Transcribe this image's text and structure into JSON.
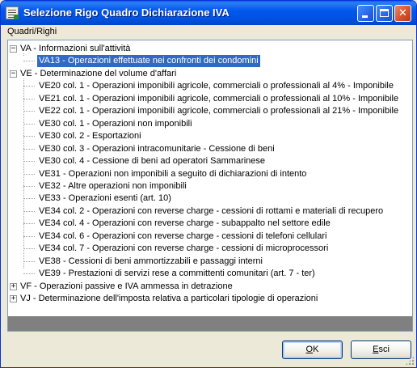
{
  "window": {
    "title": "Selezione Rigo Quadro Dichiarazione IVA",
    "titlebar_color": "#0054e3",
    "controls": {
      "minimize": "minimize-icon",
      "maximize": "maximize-icon",
      "close": "close-icon",
      "close_glyph": "✕"
    }
  },
  "tree": {
    "label": "Quadri/Righi",
    "groups": [
      {
        "expander": "−",
        "label": "VA - Informazioni sull'attività",
        "children": [
          {
            "label": "VA13 - Operazioni effettuate nei confronti dei condomini",
            "selected": true
          }
        ]
      },
      {
        "expander": "−",
        "label": "VE - Determinazione del volume d'affari",
        "children": [
          {
            "label": "VE20 col. 1 - Operazioni imponibili agricole, commerciali o professionali al 4% - Imponibile"
          },
          {
            "label": "VE21 col. 1 - Operazioni imponibili agricole, commerciali o professionali al 10% - Imponibile"
          },
          {
            "label": "VE22 col. 1 - Operazioni imponibili agricole, commerciali o professionali al 21% - Imponibile"
          },
          {
            "label": "VE30 col. 1 - Operazioni non imponibili"
          },
          {
            "label": "VE30 col. 2 - Esportazioni"
          },
          {
            "label": "VE30 col. 3 - Operazioni intracomunitarie - Cessione di beni"
          },
          {
            "label": "VE30 col. 4 - Cessione di beni ad operatori Sammarinese"
          },
          {
            "label": "VE31 - Operazioni non imponibili a seguito di dichiarazioni di intento"
          },
          {
            "label": "VE32 - Altre operazioni non imponibili"
          },
          {
            "label": "VE33 - Operazioni esenti (art. 10)"
          },
          {
            "label": "VE34 col. 2 - Operazioni con reverse charge - cessioni di rottami e materiali di recupero"
          },
          {
            "label": "VE34 col. 4 - Operazioni con reverse charge - subappalto nel settore edile"
          },
          {
            "label": "VE34 col. 6 - Operazioni con reverse charge - cessioni di telefoni cellulari"
          },
          {
            "label": "VE34 col. 7 - Operazioni con reverse charge - cessioni di microprocessori"
          },
          {
            "label": "VE38 - Cessioni di beni ammortizzabili e passaggi interni"
          },
          {
            "label": "VE39 - Prestazioni di servizi rese a committenti comunitari (art. 7 - ter)"
          }
        ]
      },
      {
        "expander": "+",
        "label": "VF - Operazioni passive e IVA ammessa in detrazione",
        "children": []
      },
      {
        "expander": "+",
        "label": "VJ - Determinazione dell'imposta relativa a particolari tipologie di operazioni",
        "children": []
      }
    ]
  },
  "buttons": {
    "ok": "OK",
    "exit": "Esci"
  },
  "colors": {
    "selection": "#316ac5",
    "window_bg": "#ece9d8"
  }
}
